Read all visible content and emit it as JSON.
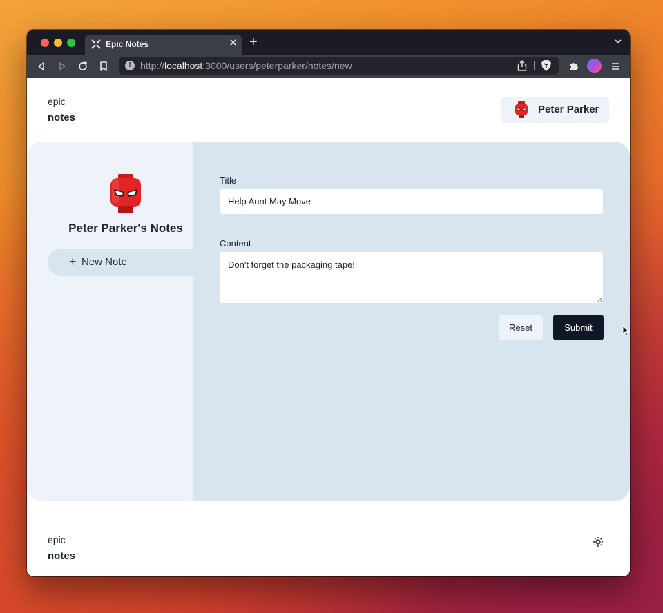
{
  "browser": {
    "tab_title": "Epic Notes",
    "tab_close": "✕",
    "new_tab": "+",
    "url_scheme": "http://",
    "url_host": "localhost",
    "url_path": ":3000/users/peterparker/notes/new",
    "info_glyph": "!"
  },
  "header": {
    "logo_line1": "epic",
    "logo_line2": "notes",
    "user_name": "Peter Parker"
  },
  "sidebar": {
    "title": "Peter Parker's Notes",
    "new_note_icon": "+",
    "new_note_label": "New Note"
  },
  "form": {
    "title_label": "Title",
    "title_value": "Help Aunt May Move",
    "content_label": "Content",
    "content_value": "Don't forget the packaging tape!",
    "reset_label": "Reset",
    "submit_label": "Submit"
  },
  "footer": {
    "logo_line1": "epic",
    "logo_line2": "notes"
  },
  "colors": {
    "accent_dark": "#101827",
    "panel": "#d9e5ee",
    "sidebar": "#eef3f9"
  },
  "icons": [
    "epic-logo-icon",
    "back-icon",
    "forward-icon",
    "reload-icon",
    "bookmark-icon",
    "info-icon",
    "share-icon",
    "brave-shield-icon",
    "extensions-icon",
    "menu-icon",
    "spiderman-avatar-icon",
    "sun-icon"
  ]
}
